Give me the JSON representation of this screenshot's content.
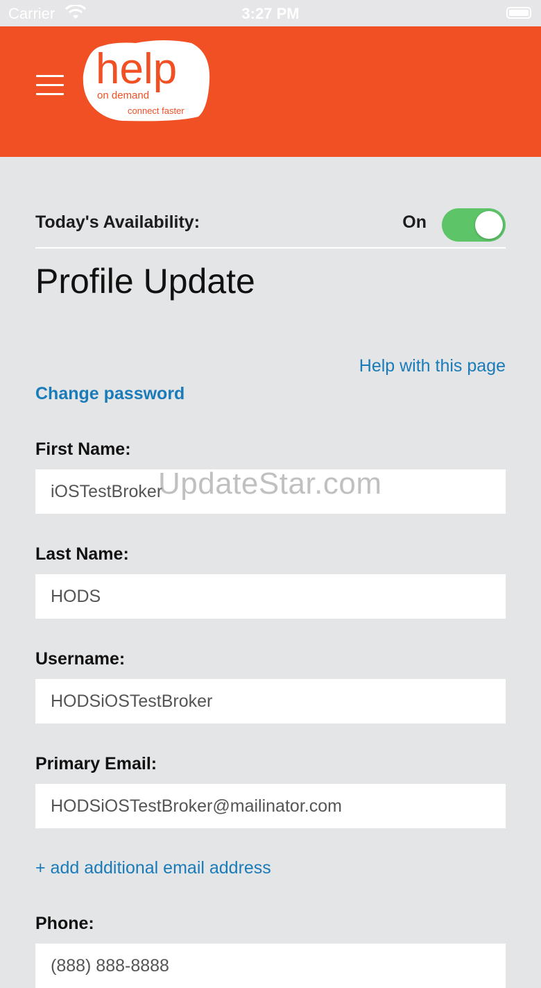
{
  "status_bar": {
    "carrier": "Carrier",
    "time": "3:27 PM",
    "wifi_icon": "wifi-icon",
    "battery_icon": "battery-icon"
  },
  "header": {
    "background_color": "#f15025",
    "menu_icon": "hamburger-menu-icon",
    "logo": {
      "word": "help",
      "tagline_top": "on demand",
      "tagline_bottom": "connect faster"
    }
  },
  "availability": {
    "label": "Today's Availability:",
    "state": "On",
    "enabled": true,
    "toggle_color": "#5dc468"
  },
  "page": {
    "title": "Profile Update",
    "help_link": "Help with this page",
    "change_password": "Change password"
  },
  "form": {
    "first_name": {
      "label": "First Name:",
      "value": "iOSTestBroker"
    },
    "last_name": {
      "label": "Last Name:",
      "value": "HODS"
    },
    "username": {
      "label": "Username:",
      "value": "HODSiOSTestBroker"
    },
    "primary_email": {
      "label": "Primary Email:",
      "value": "HODSiOSTestBroker@mailinator.com"
    },
    "add_email": "+ add additional email address",
    "phone": {
      "label": "Phone:",
      "value": "(888) 888-8888"
    }
  },
  "watermark": "UpdateStar.com",
  "colors": {
    "accent_link": "#1a7bb9",
    "page_background": "#e4e5e7"
  }
}
